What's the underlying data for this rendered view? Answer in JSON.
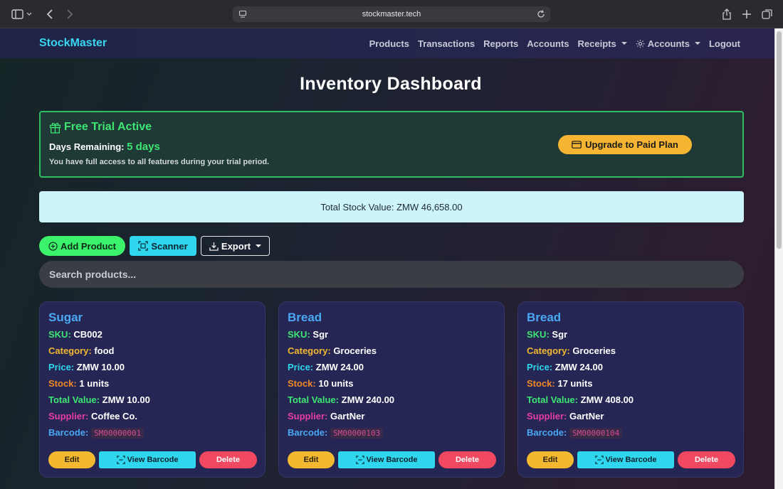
{
  "browser": {
    "url": "stockmaster.tech"
  },
  "navbar": {
    "brand": "StockMaster",
    "links": {
      "products": "Products",
      "transactions": "Transactions",
      "reports": "Reports",
      "accounts": "Accounts",
      "receipts": "Receipts",
      "accounts_menu": "Accounts",
      "logout": "Logout"
    }
  },
  "page_title": "Inventory Dashboard",
  "trial": {
    "title": "Free Trial Active",
    "days_label": "Days Remaining:",
    "days_value": "5 days",
    "note": "You have full access to all features during your trial period.",
    "upgrade_label": "Upgrade to Paid Plan"
  },
  "stock_value": "Total Stock Value: ZMW 46,658.00",
  "actions": {
    "add_label": "Add Product",
    "scanner_label": "Scanner",
    "export_label": "Export"
  },
  "search": {
    "placeholder": "Search products..."
  },
  "field_labels": {
    "sku": "SKU:",
    "category": "Category:",
    "price": "Price:",
    "stock": "Stock:",
    "total": "Total Value:",
    "supplier": "Supplier:",
    "barcode": "Barcode:"
  },
  "card_buttons": {
    "edit": "Edit",
    "view": "View Barcode",
    "delete": "Delete"
  },
  "products": [
    {
      "name": "Sugar",
      "sku": "CB002",
      "category": "food",
      "price": "ZMW 10.00",
      "stock": "1 units",
      "total": "ZMW 10.00",
      "supplier": "Coffee Co.",
      "barcode": "SM00000001"
    },
    {
      "name": "Bread",
      "sku": "Sgr",
      "category": "Groceries",
      "price": "ZMW 24.00",
      "stock": "10 units",
      "total": "ZMW 240.00",
      "supplier": "GartNer",
      "barcode": "SM00000103"
    },
    {
      "name": "Bread",
      "sku": "Sgr",
      "category": "Groceries",
      "price": "ZMW 24.00",
      "stock": "17 units",
      "total": "ZMW 408.00",
      "supplier": "GartNer",
      "barcode": "SM00000104"
    }
  ],
  "colors": {
    "brand": "#38d6f0",
    "success": "#3ee672",
    "warning": "#f2b830",
    "danger": "#f04860",
    "info": "#2fd7ee"
  }
}
